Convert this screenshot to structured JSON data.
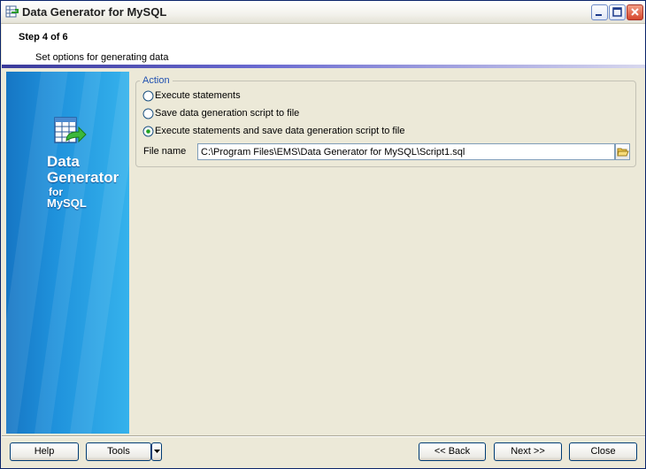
{
  "window": {
    "title": "Data Generator  for MySQL"
  },
  "header": {
    "step": "Step 4 of 6",
    "description": "Set options for generating data"
  },
  "side_panel": {
    "line1": "Data",
    "line2": "Generator",
    "line3": "for",
    "line4": "MySQL"
  },
  "action_group": {
    "legend": "Action",
    "options": [
      {
        "label": "Execute statements",
        "selected": false
      },
      {
        "label": "Save data generation script to file",
        "selected": false
      },
      {
        "label": "Execute statements and save data generation script to file",
        "selected": true
      }
    ],
    "file_label": "File name",
    "file_value": "C:\\Program Files\\EMS\\Data Generator for MySQL\\Script1.sql"
  },
  "buttons": {
    "help": "Help",
    "tools": "Tools",
    "back": "<< Back",
    "next": "Next >>",
    "close": "Close"
  },
  "colors": {
    "accent": "#2050b0",
    "side_panel": "#1f92dc",
    "window_bg": "#ECE9D8"
  }
}
